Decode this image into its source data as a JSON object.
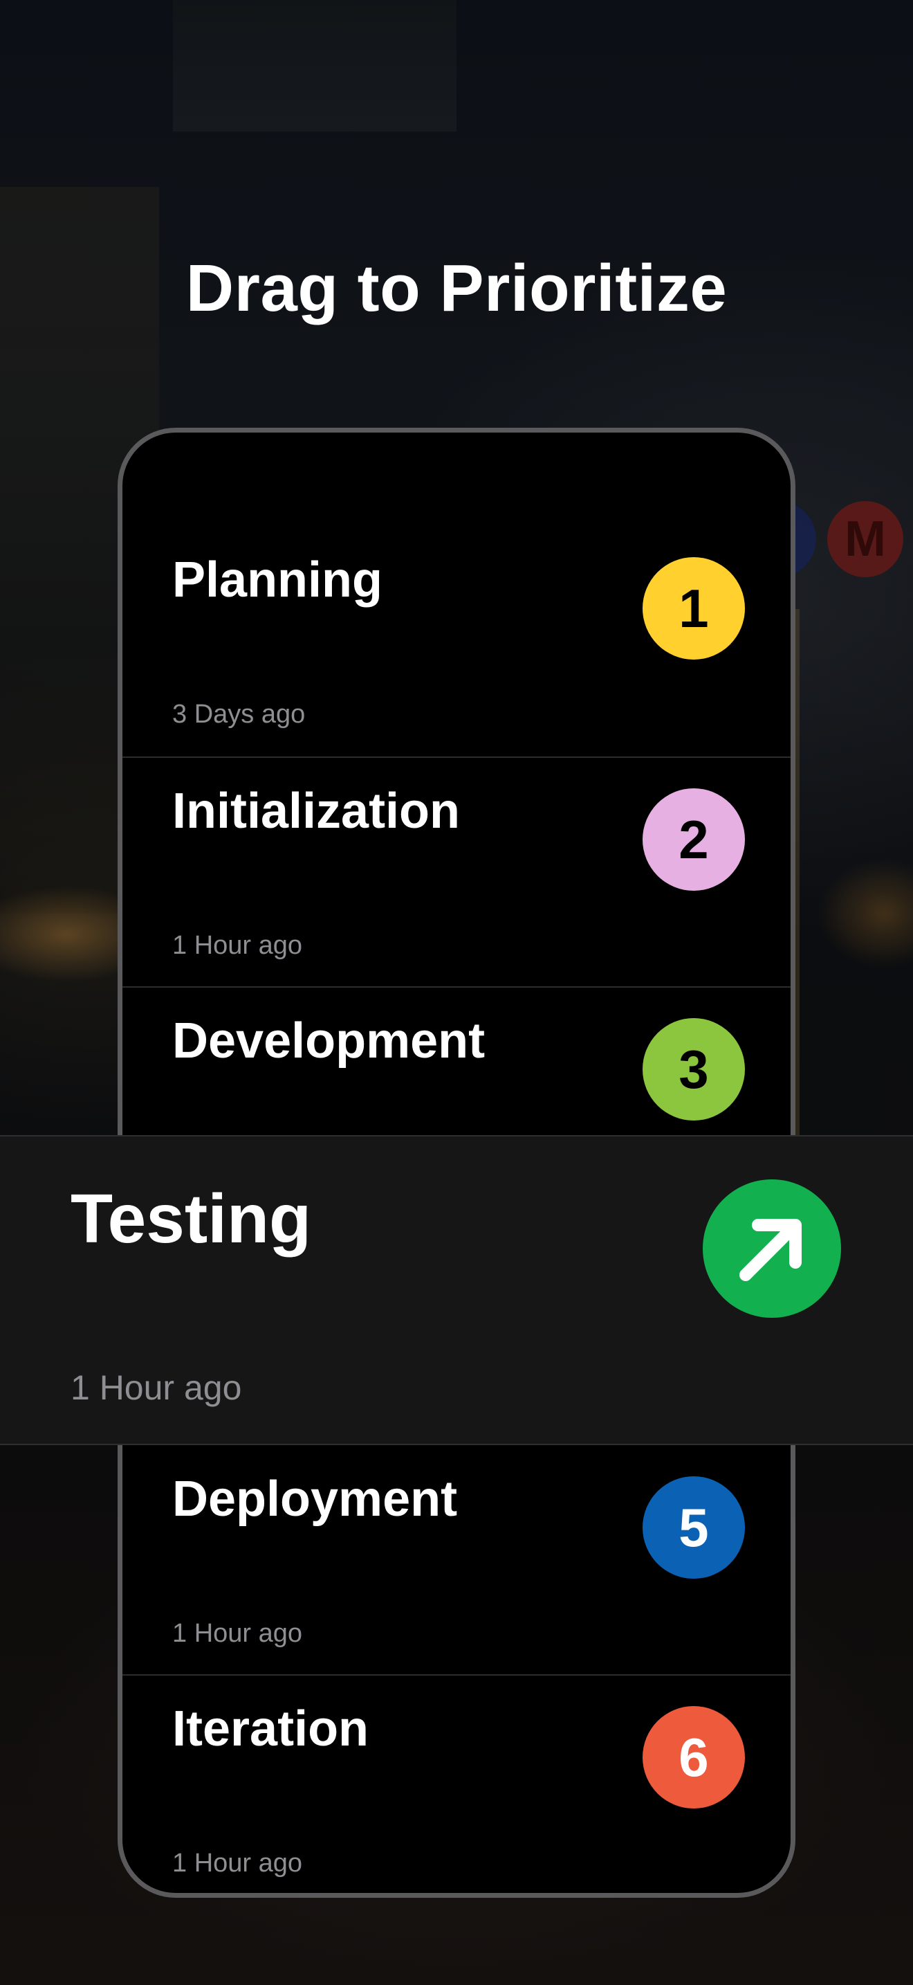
{
  "title": "Drag to Prioritize",
  "background_sign": "M",
  "rows": [
    {
      "title": "Planning",
      "time": "3 Days ago",
      "badge": "1",
      "badge_color": "#FFD02E",
      "badge_text_color": "#000000"
    },
    {
      "title": "Initialization",
      "time": "1 Hour ago",
      "badge": "2",
      "badge_color": "#E6B1E2",
      "badge_text_color": "#000000"
    },
    {
      "title": "Development",
      "time": "",
      "badge": "3",
      "badge_color": "#8CC63F",
      "badge_text_color": "#000000"
    },
    {
      "title": "Deployment",
      "time": "1 Hour ago",
      "badge": "5",
      "badge_color": "#0B62B4",
      "badge_text_color": "#FFFFFF"
    },
    {
      "title": "Iteration",
      "time": "1 Hour ago",
      "badge": "6",
      "badge_color": "#EE5A3C",
      "badge_text_color": "#FFFFFF"
    }
  ],
  "dragging": {
    "title": "Testing",
    "time": "1 Hour ago",
    "icon": "arrow-up-right-icon",
    "badge_color": "#12B04F"
  }
}
